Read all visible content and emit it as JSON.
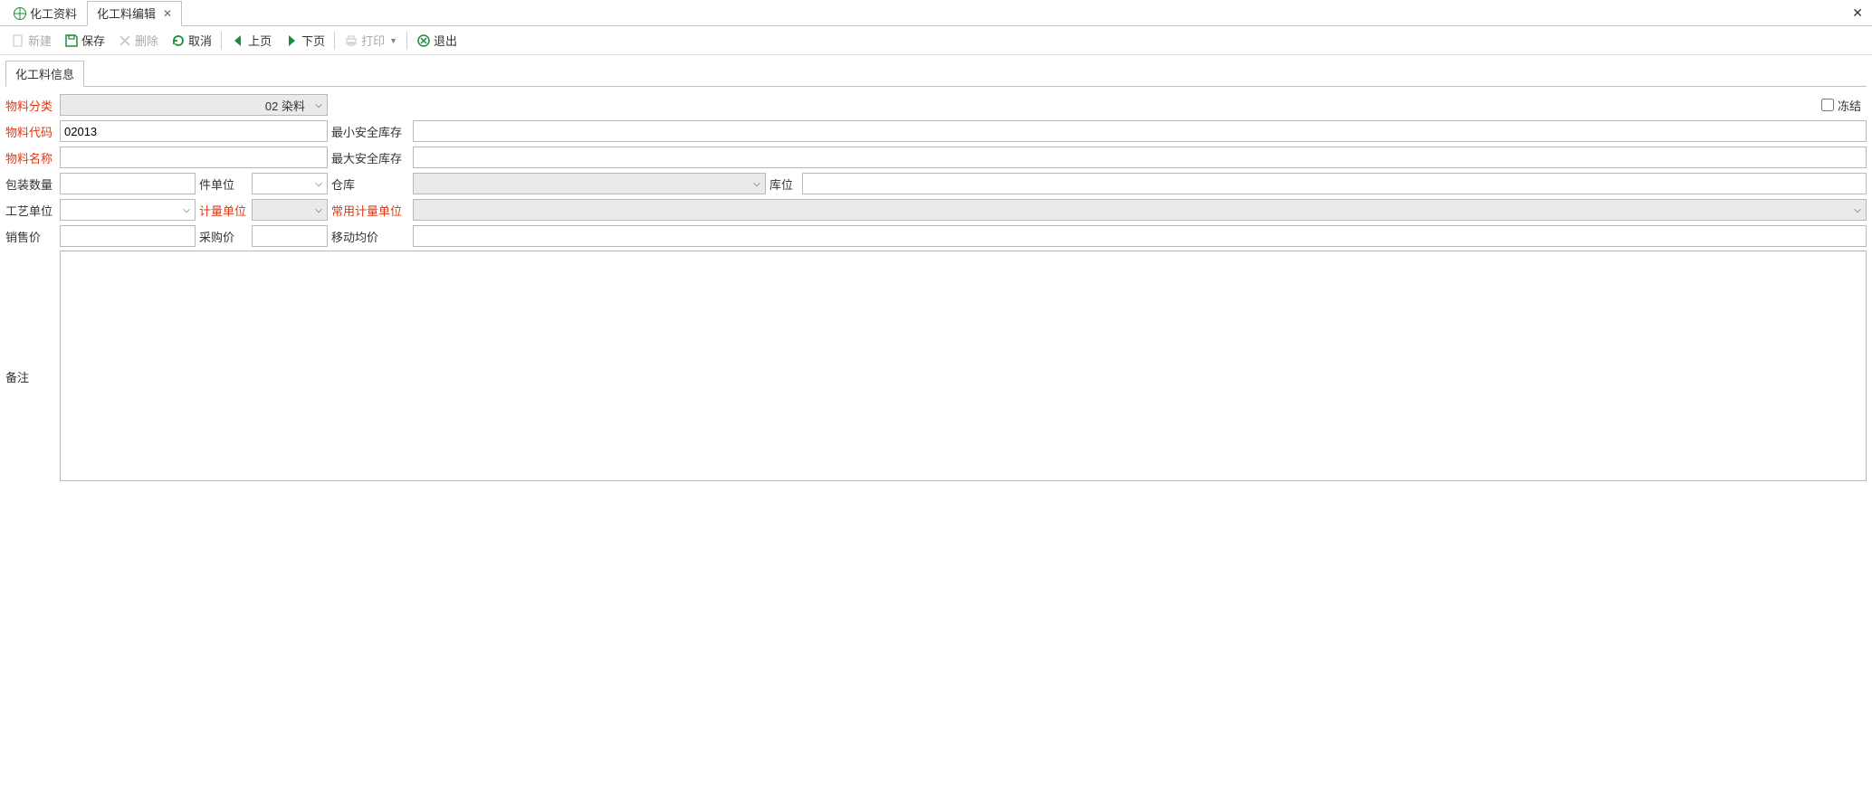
{
  "tabs": {
    "tab1": "化工资料",
    "tab2": "化工料编辑"
  },
  "toolbar": {
    "new": "新建",
    "save": "保存",
    "delete": "删除",
    "cancel": "取消",
    "prev": "上页",
    "next": "下页",
    "print": "打印",
    "exit": "退出"
  },
  "contentTab": "化工料信息",
  "labels": {
    "materialCategory": "物料分类",
    "materialCode": "物料代码",
    "materialName": "物料名称",
    "packQty": "包装数量",
    "pieceUnit": "件单位",
    "processUnit": "工艺单位",
    "measureUnit": "计量单位",
    "salePrice": "销售价",
    "purchasePrice": "采购价",
    "freeze": "冻结",
    "minSafeStock": "最小安全库存",
    "maxSafeStock": "最大安全库存",
    "warehouse": "仓库",
    "location": "库位",
    "commonMeasureUnit": "常用计量单位",
    "movingAvgPrice": "移动均价",
    "remark": "备注"
  },
  "values": {
    "materialCategory": "02 染料",
    "materialCode": "02013",
    "materialName": "",
    "packQty": "",
    "pieceUnit": "",
    "processUnit": "",
    "measureUnit": "",
    "salePrice": "",
    "purchasePrice": "",
    "minSafeStock": "",
    "maxSafeStock": "",
    "warehouse": "",
    "location": "",
    "commonMeasureUnit": "",
    "movingAvgPrice": "",
    "remark": "",
    "freezeChecked": false
  }
}
